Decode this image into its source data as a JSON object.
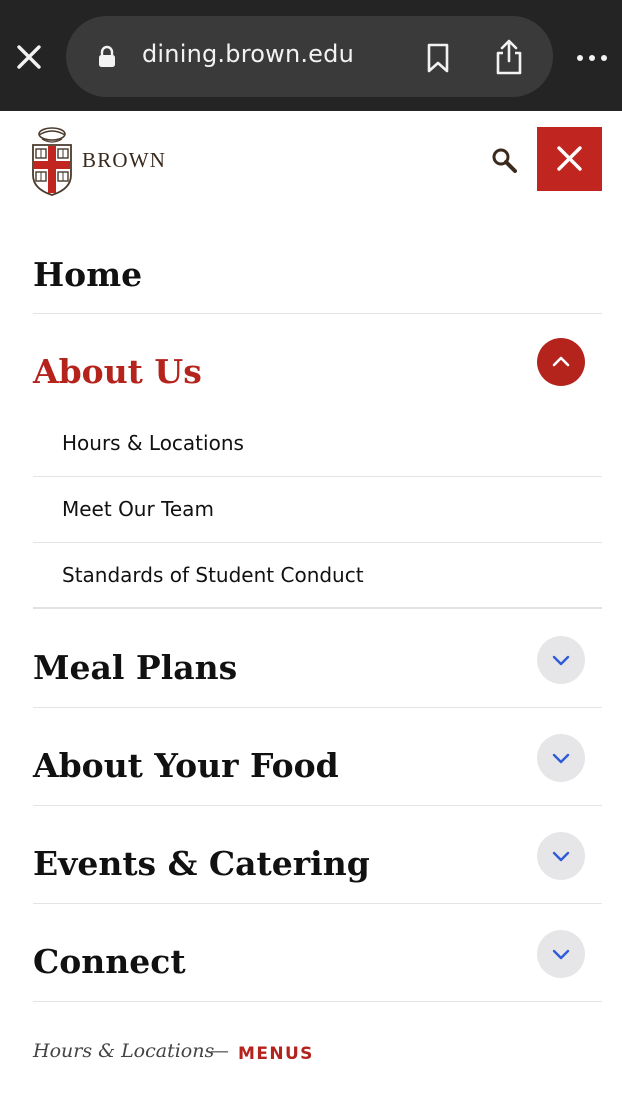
{
  "browser": {
    "url": "dining.brown.edu",
    "icons": [
      "close-icon",
      "lock-icon",
      "bookmark-icon",
      "share-icon",
      "more-icon"
    ]
  },
  "header": {
    "logo_text": "BROWN",
    "icons": [
      "brown-shield-logo",
      "search-icon",
      "close-icon"
    ]
  },
  "nav": {
    "home": "Home",
    "about_us": "About Us",
    "about_us_children": [
      "Hours & Locations",
      "Meet Our Team",
      "Standards of Student Conduct"
    ],
    "meal_plans": "Meal Plans",
    "about_your_food": "About Your Food",
    "events_catering": "Events & Catering",
    "connect": "Connect"
  },
  "footer": {
    "breadcrumb": "Hours & Locations",
    "separator": "—",
    "menus": "MENUS"
  },
  "colors": {
    "accent": "#b5231d",
    "chrome_bg": "#242424",
    "toggle_bg": "#e6e6e8",
    "chevron_blue": "#2e5bd8"
  }
}
